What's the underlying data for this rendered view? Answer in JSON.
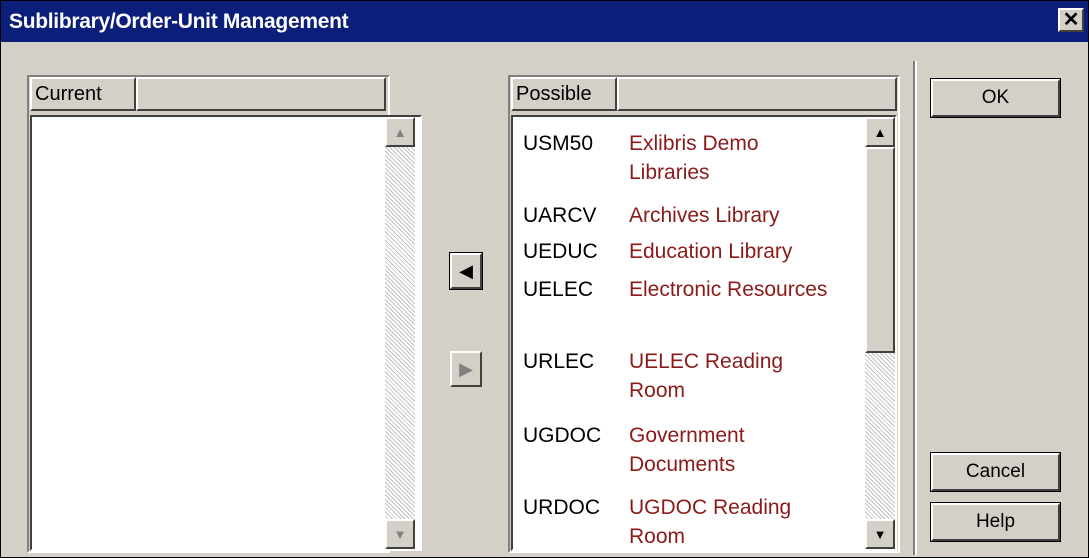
{
  "window": {
    "title": "Sublibrary/Order-Unit Management"
  },
  "icons": {
    "close": "close-icon",
    "move_left": "triangle-left-icon",
    "move_right": "triangle-right-icon",
    "scroll_up": "triangle-up-icon",
    "scroll_down": "triangle-down-icon"
  },
  "current": {
    "header": "Current",
    "items": []
  },
  "possible": {
    "header": "Possible",
    "items": [
      {
        "code": "USM50",
        "name": "Exlibris Demo Libraries"
      },
      {
        "code": "UARCV",
        "name": "Archives Library"
      },
      {
        "code": "UEDUC",
        "name": "Education Library"
      },
      {
        "code": "UELEC",
        "name": "Electronic Resources"
      },
      {
        "code": "URLEC",
        "name": "UELEC Reading Room"
      },
      {
        "code": "UGDOC",
        "name": "Government Documents"
      },
      {
        "code": "URDOC",
        "name": "UGDOC Reading Room"
      }
    ]
  },
  "buttons": {
    "ok": "OK",
    "cancel": "Cancel",
    "help": "Help"
  },
  "colors": {
    "titlebar": "#0a1e7a",
    "item_name": "#8b1a1a",
    "face": "#d4d0c8"
  }
}
